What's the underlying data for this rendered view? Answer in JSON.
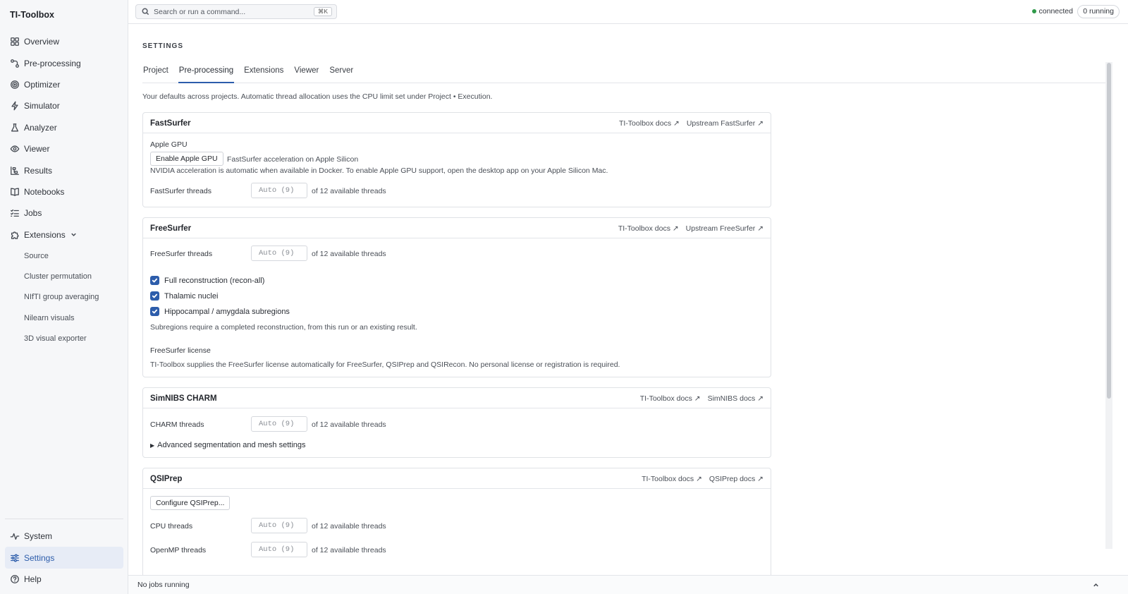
{
  "app": {
    "title": "TI-Toolbox"
  },
  "sidebar": {
    "items": [
      {
        "label": "Overview",
        "icon": "grid-icon"
      },
      {
        "label": "Pre-processing",
        "icon": "pipeline-icon"
      },
      {
        "label": "Optimizer",
        "icon": "target-icon"
      },
      {
        "label": "Simulator",
        "icon": "bolt-icon"
      },
      {
        "label": "Analyzer",
        "icon": "flask-icon"
      },
      {
        "label": "Viewer",
        "icon": "eye-icon"
      },
      {
        "label": "Results",
        "icon": "results-icon"
      },
      {
        "label": "Notebooks",
        "icon": "book-icon"
      },
      {
        "label": "Jobs",
        "icon": "list-icon"
      },
      {
        "label": "Extensions",
        "icon": "puzzle-icon"
      }
    ],
    "extensions_sub": [
      "Source",
      "Cluster permutation",
      "NIfTI group averaging",
      "Nilearn visuals",
      "3D visual exporter"
    ],
    "bottom_items": [
      {
        "label": "System",
        "icon": "activity-icon"
      },
      {
        "label": "Settings",
        "icon": "sliders-icon"
      },
      {
        "label": "Help",
        "icon": "help-icon"
      }
    ]
  },
  "topbar": {
    "search_placeholder": "Search or run a command...",
    "shortcut": "⌘K",
    "status": "connected",
    "running": "0 running"
  },
  "settings": {
    "heading": "SETTINGS",
    "tabs": [
      "Project",
      "Pre-processing",
      "Extensions",
      "Viewer",
      "Server"
    ],
    "active_tab": "Pre-processing",
    "intro": "Your defaults across projects. Automatic thread allocation uses the CPU limit set under Project • Execution."
  },
  "threads": {
    "placeholder": "Auto (9)",
    "suffix": "of 12 available threads"
  },
  "fastsurfer": {
    "title": "FastSurfer",
    "links": [
      "TI-Toolbox docs ↗",
      "Upstream FastSurfer ↗"
    ],
    "apple_gpu_label": "Apple GPU",
    "apple_gpu_button": "Enable Apple GPU",
    "apple_gpu_desc": "FastSurfer acceleration on Apple Silicon",
    "apple_gpu_note": "NVIDIA acceleration is automatic when available in Docker. To enable Apple GPU support, open the desktop app on your Apple Silicon Mac.",
    "threads_label": "FastSurfer threads"
  },
  "freesurfer": {
    "title": "FreeSurfer",
    "links": [
      "TI-Toolbox docs ↗",
      "Upstream FreeSurfer ↗"
    ],
    "threads_label": "FreeSurfer threads",
    "checks": [
      "Full reconstruction (recon-all)",
      "Thalamic nuclei",
      "Hippocampal / amygdala subregions"
    ],
    "subregions_note": "Subregions require a completed reconstruction, from this run or an existing result.",
    "license_label": "FreeSurfer license",
    "license_note": "TI-Toolbox supplies the FreeSurfer license automatically for FreeSurfer, QSIPrep and QSIRecon. No personal license or registration is required."
  },
  "charm": {
    "title": "SimNIBS CHARM",
    "links": [
      "TI-Toolbox docs ↗",
      "SimNIBS docs ↗"
    ],
    "threads_label": "CHARM threads",
    "advanced": "Advanced segmentation and mesh settings"
  },
  "qsiprep": {
    "title": "QSIPrep",
    "links": [
      "TI-Toolbox docs ↗",
      "QSIPrep docs ↗"
    ],
    "configure_button": "Configure QSIPrep...",
    "cpu_label": "CPU threads",
    "omp_label": "OpenMP threads"
  },
  "bottombar": {
    "status": "No jobs running"
  },
  "colors": {
    "accent": "#2d5dab",
    "connected": "#2f9a4a"
  }
}
